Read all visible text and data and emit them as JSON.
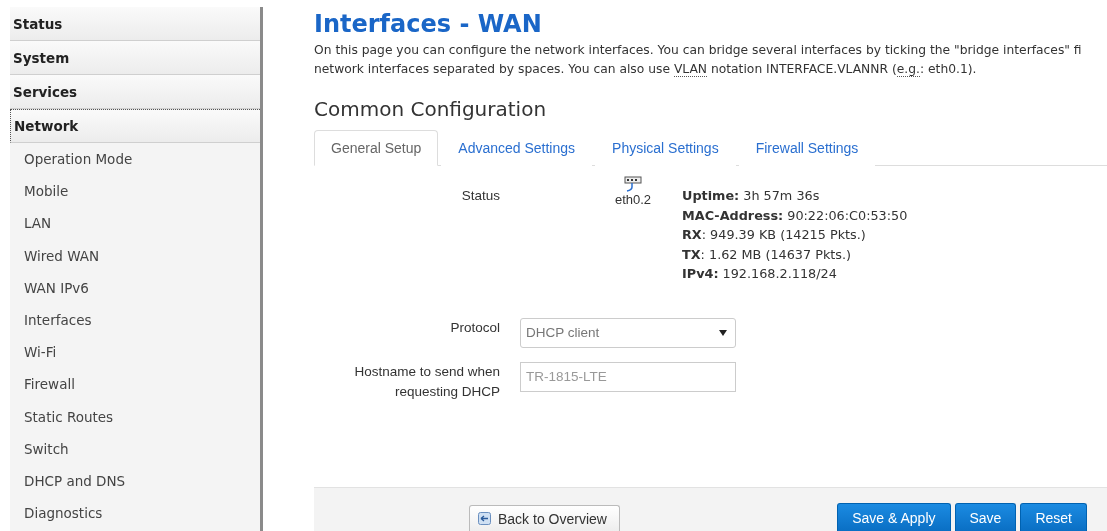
{
  "sidebar": {
    "sections": [
      {
        "label": "Status",
        "expanded": false
      },
      {
        "label": "System",
        "expanded": false
      },
      {
        "label": "Services",
        "expanded": false
      },
      {
        "label": "Network",
        "expanded": true,
        "children": [
          {
            "label": "Operation Mode"
          },
          {
            "label": "Mobile"
          },
          {
            "label": "LAN"
          },
          {
            "label": "Wired WAN"
          },
          {
            "label": "WAN IPv6"
          },
          {
            "label": "Interfaces"
          },
          {
            "label": "Wi-Fi"
          },
          {
            "label": "Firewall"
          },
          {
            "label": "Static Routes"
          },
          {
            "label": "Switch"
          },
          {
            "label": "DHCP and DNS"
          },
          {
            "label": "Diagnostics"
          }
        ]
      }
    ]
  },
  "page": {
    "title": "Interfaces - WAN",
    "description_lines": [
      [
        {
          "text": "On this page you can configure the network interfaces. You can bridge several interfaces by ticking the \"bridge interfaces\" fi",
          "abbr": false
        }
      ],
      [
        {
          "text": "network interfaces separated by spaces. You can also use ",
          "abbr": false
        },
        {
          "text": "VLAN",
          "abbr": true
        },
        {
          "text": " notation INTERFACE.VLANNR (",
          "abbr": false
        },
        {
          "text": "e.g.",
          "abbr": true
        },
        {
          "text": ": eth0.1).",
          "abbr": false
        }
      ]
    ]
  },
  "section_title": "Common Configuration",
  "tabs": [
    {
      "label": "General Setup",
      "selected": true
    },
    {
      "label": "Advanced Settings",
      "selected": false
    },
    {
      "label": "Physical Settings",
      "selected": false
    },
    {
      "label": "Firewall Settings",
      "selected": false
    }
  ],
  "status": {
    "label": "Status",
    "device": "eth0.2",
    "lines": [
      {
        "key": "Uptime:",
        "value": " 3h 57m 36s"
      },
      {
        "key": "MAC-Address:",
        "value": " 90:22:06:C0:53:50"
      },
      {
        "key": "RX",
        "value": ": 949.39 KB (14215 Pkts.)"
      },
      {
        "key": "TX",
        "value": ": 1.62 MB (14637 Pkts.)"
      },
      {
        "key": "IPv4:",
        "value": " 192.168.2.118/24"
      }
    ]
  },
  "fields": [
    {
      "kind": "select",
      "label": "Protocol",
      "value": "DHCP client"
    },
    {
      "kind": "text",
      "label": "Hostname to send when requesting DHCP",
      "placeholder": "TR-1815-LTE"
    }
  ],
  "footer": {
    "back": "Back to Overview",
    "actions": [
      "Save & Apply",
      "Save",
      "Reset"
    ]
  }
}
